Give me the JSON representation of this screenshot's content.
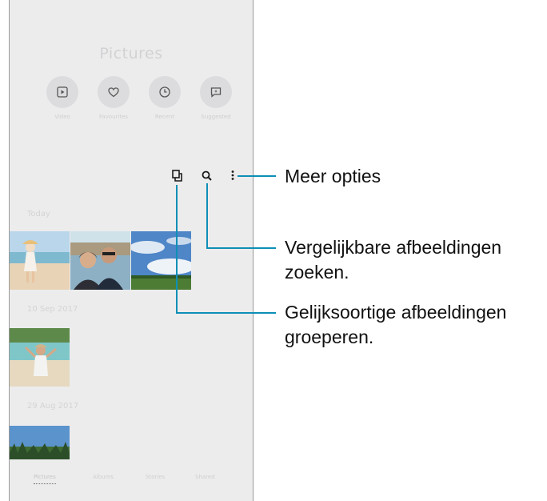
{
  "app": {
    "title": "Pictures"
  },
  "quick_actions": [
    {
      "label": "Video",
      "icon": "play-icon"
    },
    {
      "label": "Favourites",
      "icon": "heart-icon"
    },
    {
      "label": "Recent",
      "icon": "clock-icon"
    },
    {
      "label": "Suggested",
      "icon": "sparkle-chat-icon"
    }
  ],
  "toolbar": {
    "group_icon": "group-similar-icon",
    "search_icon": "search-icon",
    "more_icon": "more-options-icon"
  },
  "sections": [
    {
      "date": "Today"
    },
    {
      "date": "10 Sep 2017"
    },
    {
      "date": "29 Aug 2017"
    }
  ],
  "bottom_nav": [
    "Pictures",
    "Albums",
    "Stories",
    "Shared"
  ],
  "callouts": {
    "more_options": "Meer opties",
    "search_similar_line1": "Vergelijkbare afbeeldingen",
    "search_similar_line2": "zoeken.",
    "group_similar_line1": "Gelijksoortige afbeeldingen",
    "group_similar_line2": "groeperen."
  },
  "colors": {
    "callout_line": "#0d8fb6",
    "screen_bg": "#ececed"
  }
}
